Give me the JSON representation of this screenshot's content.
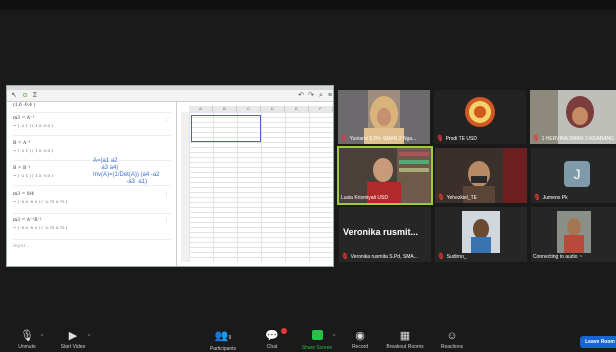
{
  "shared_screen": {
    "algebra": [
      {
        "def": "(1.6   -0.4 )",
        "mat": ""
      },
      {
        "def": "m3 = A⁻¹",
        "mat": "→ ( -2   1 ) ( 1.5  -0.5 )"
      },
      {
        "def": "B = A⁻¹",
        "mat": "→ ( -2   1 ) ( 1.5  -0.5 )"
      },
      {
        "def": "B = B⁻¹",
        "mat": "→ ( -2   1 ) ( 1.5  -0.5 )"
      },
      {
        "def": "m3 = 0/4",
        "mat": "→ ( -0.5  -0.5 ) ( -2.75  0.75 )"
      },
      {
        "def": "m3 = A⁻¹B⁻¹",
        "mat": "→ ( -0.5  -0.5 ) ( -2.75  0.75 )"
      }
    ],
    "notes": "A=(a1 a2\n     a3 a4)\nInv(A)=(1/Det(A)) (a4 -a2\n                    -a3  a1)",
    "columns": [
      "A",
      "B",
      "C",
      "D",
      "E",
      "F"
    ],
    "input_placeholder": "Input..."
  },
  "participants": [
    {
      "name": "Yuniarni S.Pd -SMAN 2 Nga...",
      "muted": true
    },
    {
      "name": "Prodi TE USD",
      "muted": true
    },
    {
      "name": "1 HERVINA SMAN 3 NGABANG",
      "muted": true
    },
    {
      "name": "Lusia Krismiyati USD",
      "muted": false
    },
    {
      "name": "Yehezkiel_TE",
      "muted": true
    },
    {
      "name": "Jumeno Pk",
      "muted": true,
      "initial": "J"
    },
    {
      "name": "Veronika rusmita S.Pd, SMA...",
      "muted": true,
      "display": "Veronika rusmit..."
    },
    {
      "name": "Sudirno_",
      "muted": true
    },
    {
      "name": "Connecting to audio",
      "muted": false
    }
  ],
  "toolbar": {
    "unmute": "Unmute",
    "start_video": "Start Video",
    "participants": "Participants",
    "participants_count": "9",
    "chat": "Chat",
    "share_screen": "Share Screen",
    "record": "Record",
    "breakout_rooms": "Breakout Rooms",
    "reactions": "Reactions",
    "leave": "Leave Room"
  },
  "colors": {
    "share_green": "#24c24a",
    "leave_blue": "#1565d8",
    "mute_red": "#e53935",
    "active_speaker": "#9ccc38"
  }
}
